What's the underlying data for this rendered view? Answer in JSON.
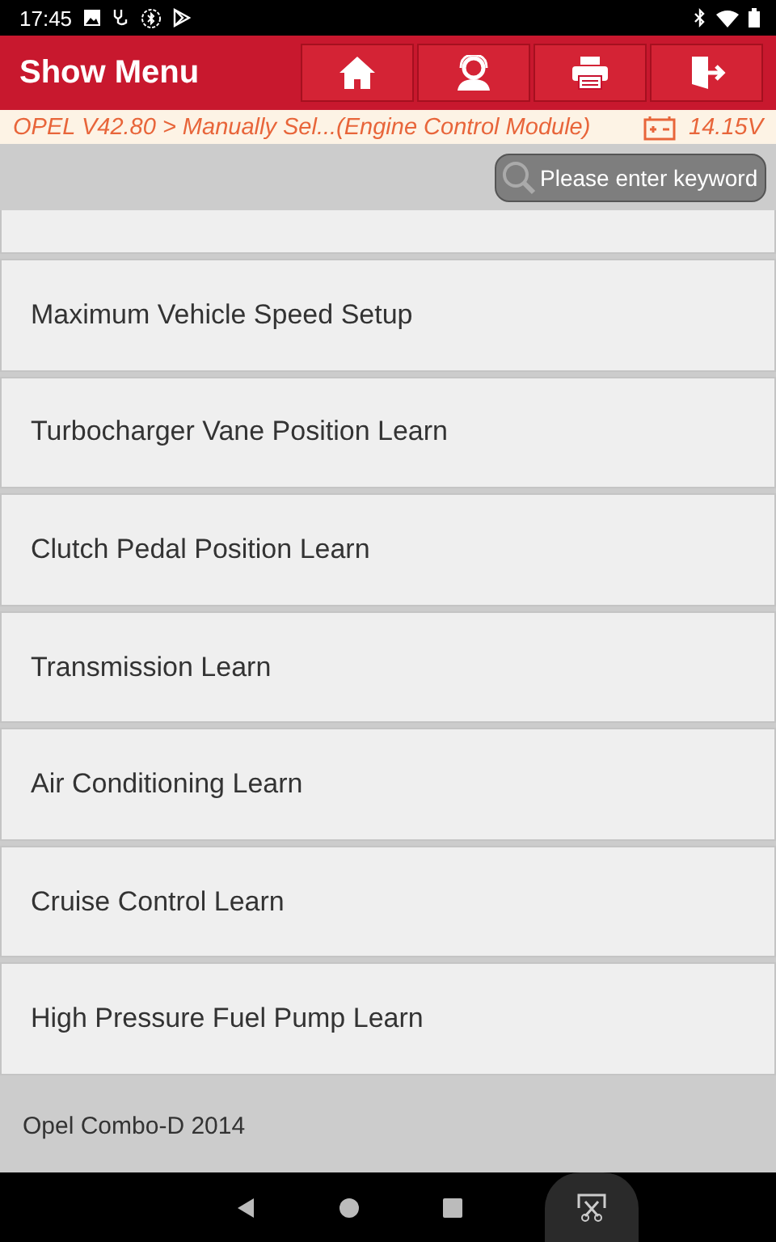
{
  "status_bar": {
    "time": "17:45"
  },
  "header": {
    "title": "Show Menu",
    "buttons": [
      {
        "kind": "home"
      },
      {
        "kind": "support"
      },
      {
        "kind": "print"
      },
      {
        "kind": "exit"
      }
    ]
  },
  "breadcrumb": {
    "path": "OPEL V42.80 > Manually Sel...(Engine Control Module)",
    "voltage": "14.15V"
  },
  "search": {
    "placeholder": "Please enter keyword"
  },
  "menu_items": [
    {
      "label": "Maximum Vehicle Speed Setup"
    },
    {
      "label": "Turbocharger Vane Position Learn"
    },
    {
      "label": "Clutch Pedal Position Learn"
    },
    {
      "label": "Transmission Learn"
    },
    {
      "label": "Air Conditioning Learn"
    },
    {
      "label": "Cruise Control Learn"
    },
    {
      "label": "High Pressure Fuel Pump Learn"
    }
  ],
  "footer": {
    "vehicle": "Opel Combo-D 2014"
  }
}
